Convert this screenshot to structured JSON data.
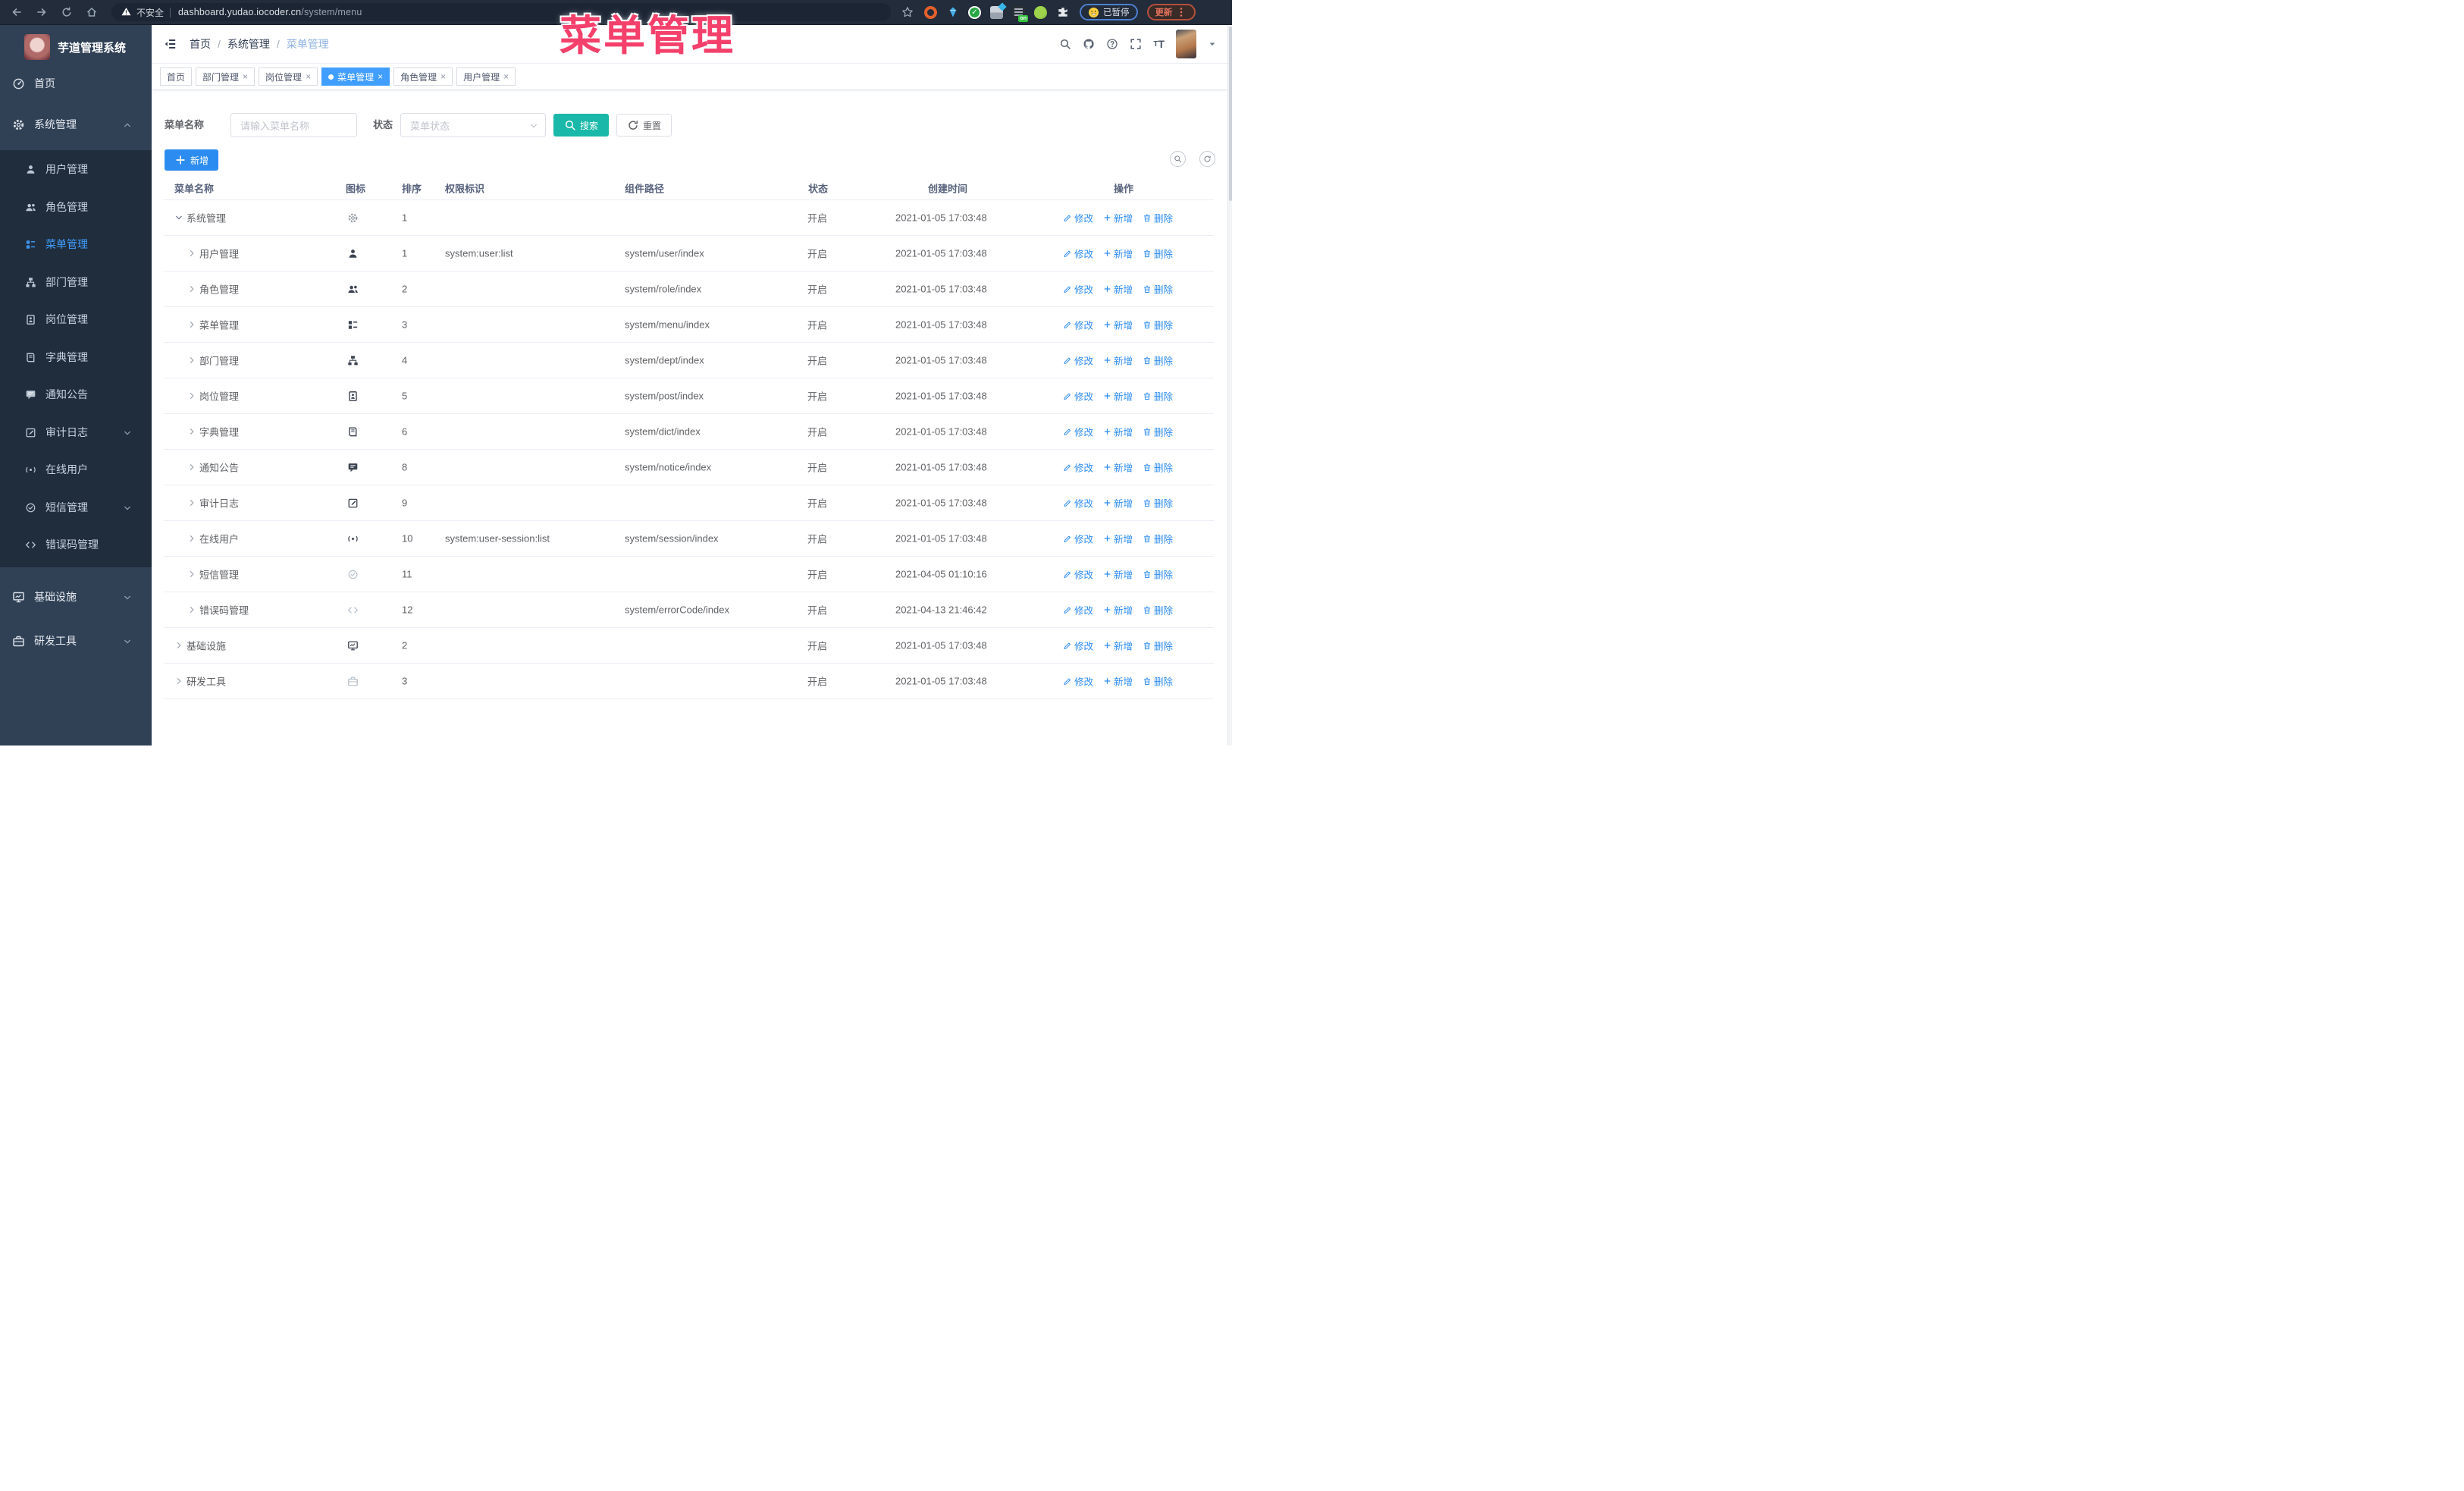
{
  "watermark": "菜单管理",
  "browser": {
    "security_label": "不安全",
    "url_host": "dashboard.yudao.iocoder.cn",
    "url_path": "/system/menu",
    "ext_on_label": "on",
    "paused_label": "已暂停",
    "update_label": "更新"
  },
  "sidebar": {
    "title": "芋道管理系统",
    "items": [
      {
        "label": "首页",
        "icon": "dashboard",
        "type": "top"
      },
      {
        "label": "系统管理",
        "icon": "gear",
        "type": "top",
        "chevron": "up"
      },
      {
        "label": "用户管理",
        "icon": "user",
        "type": "sub"
      },
      {
        "label": "角色管理",
        "icon": "users",
        "type": "sub"
      },
      {
        "label": "菜单管理",
        "icon": "menu-tree",
        "type": "sub",
        "active": true
      },
      {
        "label": "部门管理",
        "icon": "org",
        "type": "sub"
      },
      {
        "label": "岗位管理",
        "icon": "badge",
        "type": "sub"
      },
      {
        "label": "字典管理",
        "icon": "dict",
        "type": "sub"
      },
      {
        "label": "通知公告",
        "icon": "notice",
        "type": "sub"
      },
      {
        "label": "审计日志",
        "icon": "log",
        "type": "sub",
        "chevron": "down"
      },
      {
        "label": "在线用户",
        "icon": "online",
        "type": "sub"
      },
      {
        "label": "短信管理",
        "icon": "sms",
        "type": "sub",
        "chevron": "down"
      },
      {
        "label": "错误码管理",
        "icon": "code",
        "type": "sub"
      },
      {
        "label": "基础设施",
        "icon": "infra",
        "type": "top",
        "chevron": "down"
      },
      {
        "label": "研发工具",
        "icon": "tools",
        "type": "top",
        "chevron": "down"
      }
    ]
  },
  "header": {
    "breadcrumb": [
      "首页",
      "系统管理",
      "菜单管理"
    ]
  },
  "tabs": [
    {
      "label": "首页",
      "closable": false,
      "active": false
    },
    {
      "label": "部门管理",
      "closable": true,
      "active": false
    },
    {
      "label": "岗位管理",
      "closable": true,
      "active": false
    },
    {
      "label": "菜单管理",
      "closable": true,
      "active": true
    },
    {
      "label": "角色管理",
      "closable": true,
      "active": false
    },
    {
      "label": "用户管理",
      "closable": true,
      "active": false
    }
  ],
  "filters": {
    "name_label": "菜单名称",
    "name_placeholder": "请输入菜单名称",
    "status_label": "状态",
    "status_placeholder": "菜单状态",
    "search_label": "搜索",
    "reset_label": "重置"
  },
  "toolbar": {
    "add_label": "新增"
  },
  "table": {
    "columns": [
      "菜单名称",
      "图标",
      "排序",
      "权限标识",
      "组件路径",
      "状态",
      "创建时间",
      "操作"
    ],
    "row_actions": {
      "edit": "修改",
      "add": "新增",
      "delete": "删除"
    },
    "rows": [
      {
        "name": "系统管理",
        "level": 0,
        "expanded": true,
        "icon": "gear",
        "tone": "gray",
        "sort": "1",
        "perm": "",
        "path": "",
        "status": "开启",
        "created": "2021-01-05 17:03:48"
      },
      {
        "name": "用户管理",
        "level": 1,
        "expanded": false,
        "icon": "user",
        "tone": "dark",
        "sort": "1",
        "perm": "system:user:list",
        "path": "system/user/index",
        "status": "开启",
        "created": "2021-01-05 17:03:48"
      },
      {
        "name": "角色管理",
        "level": 1,
        "expanded": false,
        "icon": "users",
        "tone": "dark",
        "sort": "2",
        "perm": "",
        "path": "system/role/index",
        "status": "开启",
        "created": "2021-01-05 17:03:48"
      },
      {
        "name": "菜单管理",
        "level": 1,
        "expanded": false,
        "icon": "menu-tree",
        "tone": "dark",
        "sort": "3",
        "perm": "",
        "path": "system/menu/index",
        "status": "开启",
        "created": "2021-01-05 17:03:48"
      },
      {
        "name": "部门管理",
        "level": 1,
        "expanded": false,
        "icon": "org",
        "tone": "dark",
        "sort": "4",
        "perm": "",
        "path": "system/dept/index",
        "status": "开启",
        "created": "2021-01-05 17:03:48"
      },
      {
        "name": "岗位管理",
        "level": 1,
        "expanded": false,
        "icon": "badge",
        "tone": "dark",
        "sort": "5",
        "perm": "",
        "path": "system/post/index",
        "status": "开启",
        "created": "2021-01-05 17:03:48"
      },
      {
        "name": "字典管理",
        "level": 1,
        "expanded": false,
        "icon": "dict",
        "tone": "dark",
        "sort": "6",
        "perm": "",
        "path": "system/dict/index",
        "status": "开启",
        "created": "2021-01-05 17:03:48"
      },
      {
        "name": "通知公告",
        "level": 1,
        "expanded": false,
        "icon": "notice",
        "tone": "dark",
        "sort": "8",
        "perm": "",
        "path": "system/notice/index",
        "status": "开启",
        "created": "2021-01-05 17:03:48"
      },
      {
        "name": "审计日志",
        "level": 1,
        "expanded": false,
        "icon": "log",
        "tone": "dark",
        "sort": "9",
        "perm": "",
        "path": "",
        "status": "开启",
        "created": "2021-01-05 17:03:48"
      },
      {
        "name": "在线用户",
        "level": 1,
        "expanded": false,
        "icon": "online",
        "tone": "dark",
        "sort": "10",
        "perm": "system:user-session:list",
        "path": "system/session/index",
        "status": "开启",
        "created": "2021-01-05 17:03:48"
      },
      {
        "name": "短信管理",
        "level": 1,
        "expanded": false,
        "icon": "sms",
        "tone": "light",
        "sort": "11",
        "perm": "",
        "path": "",
        "status": "开启",
        "created": "2021-04-05 01:10:16"
      },
      {
        "name": "错误码管理",
        "level": 1,
        "expanded": false,
        "icon": "code",
        "tone": "light",
        "sort": "12",
        "perm": "",
        "path": "system/errorCode/index",
        "status": "开启",
        "created": "2021-04-13 21:46:42"
      },
      {
        "name": "基础设施",
        "level": 0,
        "expanded": false,
        "icon": "infra",
        "tone": "dark",
        "sort": "2",
        "perm": "",
        "path": "",
        "status": "开启",
        "created": "2021-01-05 17:03:48"
      },
      {
        "name": "研发工具",
        "level": 0,
        "expanded": false,
        "icon": "tools",
        "tone": "light",
        "sort": "3",
        "perm": "",
        "path": "",
        "status": "开启",
        "created": "2021-01-05 17:03:48"
      }
    ]
  }
}
